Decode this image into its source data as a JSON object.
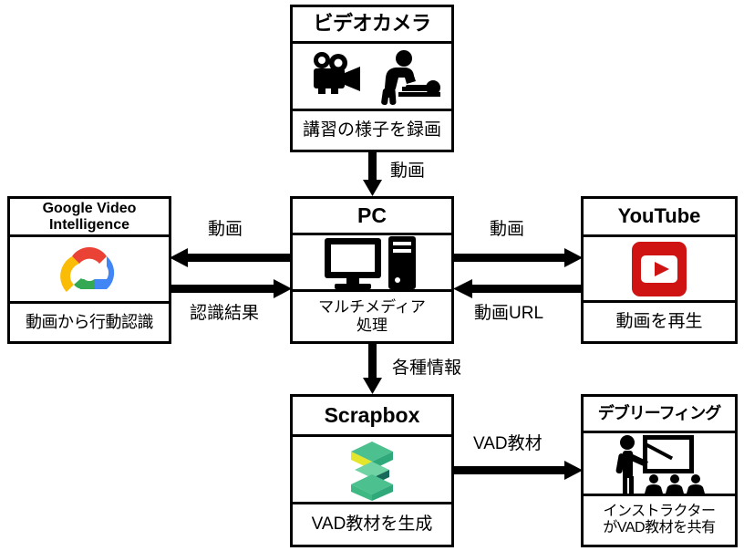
{
  "diagram": {
    "title": "VAD training system architecture flow diagram",
    "background_color": "#ffffff",
    "line_color": "#000000"
  },
  "nodes": [
    {
      "id": "camera",
      "title": "ビデオカメラ",
      "icon": "movie-camera-and-cpr-training-icon",
      "description": "講習の様子を録画"
    },
    {
      "id": "gvi",
      "title": "Google Video Intelligence",
      "title_line1": "Google Video",
      "title_line2": "Intelligence",
      "icon": "google-cloud-logo-icon",
      "description": "動画から行動認識"
    },
    {
      "id": "pc",
      "title": "PC",
      "icon": "desktop-computer-icon",
      "description": "マルチメディア処理",
      "description_line1": "マルチメディア",
      "description_line2": "処理"
    },
    {
      "id": "youtube",
      "title": "YouTube",
      "icon": "youtube-logo-icon",
      "description": "動画を再生"
    },
    {
      "id": "scrapbox",
      "title": "Scrapbox",
      "icon": "scrapbox-logo-icon",
      "description": "VAD教材を生成"
    },
    {
      "id": "debrief",
      "title": "デブリーフィング",
      "icon": "instructor-presentation-icon",
      "description": "インストラクターがVAD教材を共有",
      "description_line1": "インストラクター",
      "description_line2": "がVAD教材を共有"
    }
  ],
  "edges": [
    {
      "id": "camera-to-pc",
      "label": "動画",
      "from": "camera",
      "to": "pc",
      "direction": "down"
    },
    {
      "id": "pc-to-gvi",
      "label": "動画",
      "from": "pc",
      "to": "gvi",
      "direction": "left"
    },
    {
      "id": "gvi-to-pc",
      "label": "認識結果",
      "from": "gvi",
      "to": "pc",
      "direction": "right"
    },
    {
      "id": "pc-to-youtube",
      "label": "動画",
      "from": "pc",
      "to": "youtube",
      "direction": "right"
    },
    {
      "id": "youtube-to-pc",
      "label": "動画URL",
      "from": "youtube",
      "to": "pc",
      "direction": "left"
    },
    {
      "id": "pc-to-scrapbox",
      "label": "各種情報",
      "from": "pc",
      "to": "scrapbox",
      "direction": "down"
    },
    {
      "id": "scrapbox-to-debrief",
      "label": "VAD教材",
      "from": "scrapbox",
      "to": "debrief",
      "direction": "right"
    }
  ],
  "colors": {
    "google_red": "#EA4335",
    "google_blue": "#4285F4",
    "google_yellow": "#FBBC05",
    "google_green": "#34A853",
    "youtube_red": "#CE1312",
    "scrapbox_green": "#4CC08F",
    "scrapbox_dark": "#17695A",
    "scrapbox_yellow": "#E3E62B",
    "black": "#000000",
    "white": "#ffffff"
  }
}
